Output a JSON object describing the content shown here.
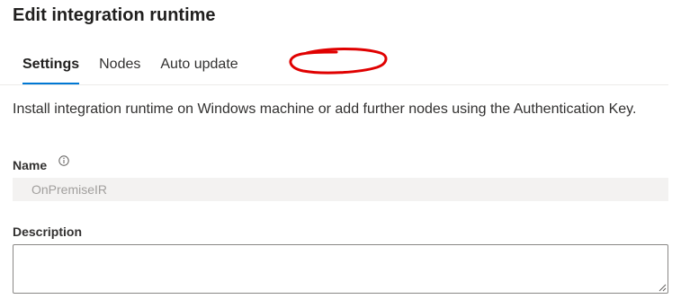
{
  "header": {
    "title": "Edit integration runtime"
  },
  "tabs": [
    {
      "label": "Settings",
      "active": true
    },
    {
      "label": "Nodes",
      "active": false
    },
    {
      "label": "Auto update",
      "active": false
    }
  ],
  "intro_text": "Install integration runtime on Windows machine or add further nodes using the Authentication Key.",
  "name_field": {
    "label": "Name",
    "value": "OnPremiseIR",
    "info_icon": "info-icon"
  },
  "description_field": {
    "label": "Description",
    "value": ""
  },
  "colors": {
    "accent": "#0078d4",
    "annotation": "#e00000",
    "disabled_bg": "#f3f2f1"
  }
}
